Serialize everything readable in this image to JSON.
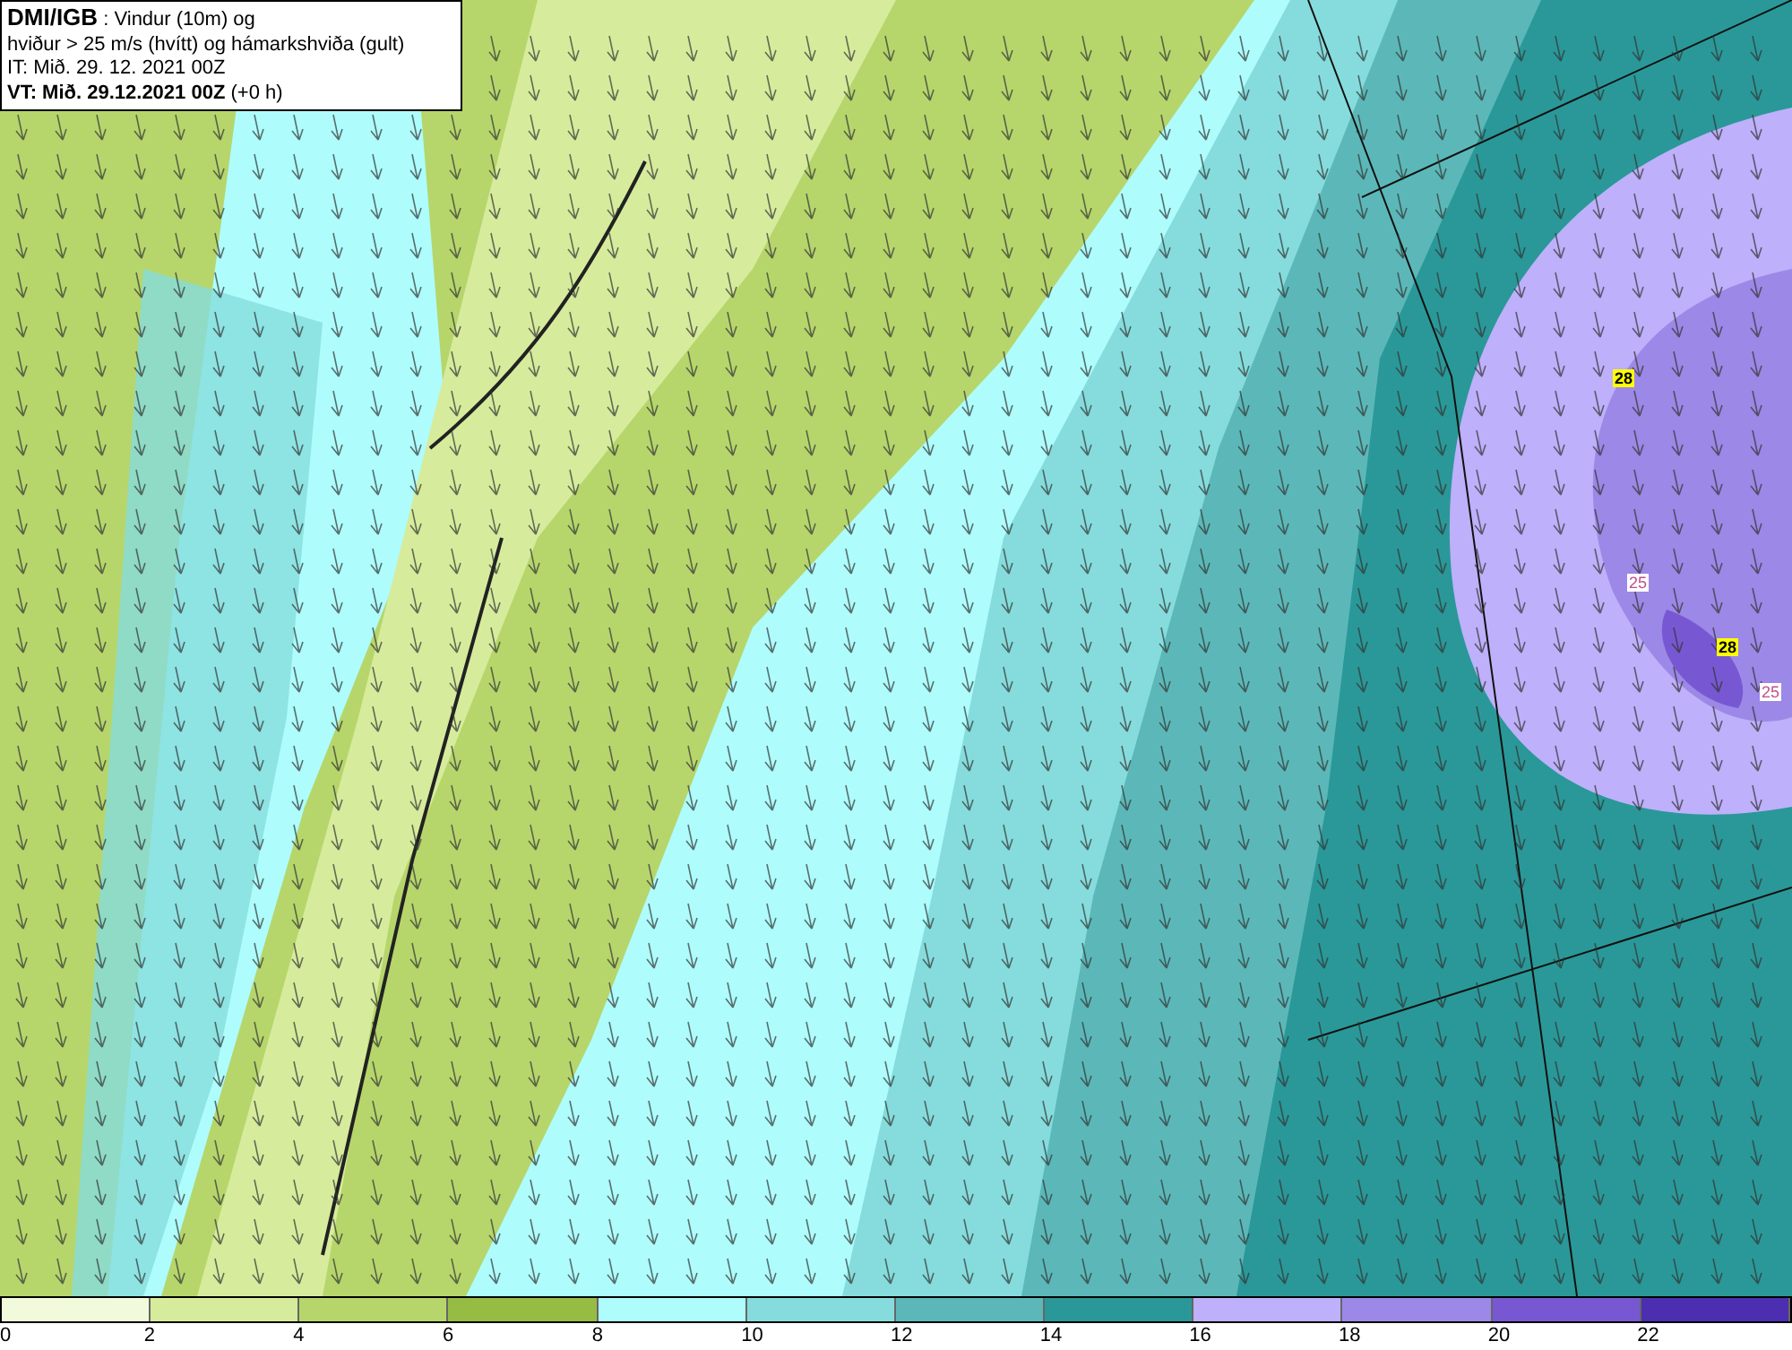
{
  "info_box": {
    "source": "DMI/IGB",
    "title": " : Vindur (10m) og",
    "subtitle": "hviður > 25 m/s (hvítt) og hámarkshviða (gult)",
    "issue_time": "IT: Mið. 29. 12. 2021 00Z",
    "valid_time": "VT: Mið. 29.12.2021 00Z",
    "offset": "(+0 h)"
  },
  "map": {
    "labels": [
      {
        "text": "28",
        "kind": "max-gust"
      },
      {
        "text": "25",
        "kind": "gust-contour"
      },
      {
        "text": "28",
        "kind": "max-gust"
      },
      {
        "text": "25",
        "kind": "gust-contour"
      }
    ]
  },
  "legend": {
    "bins": [
      {
        "color": "#f2fadc"
      },
      {
        "color": "#d6ec9c"
      },
      {
        "color": "#b6d66c"
      },
      {
        "color": "#96bc44"
      },
      {
        "color": "#aefcfc"
      },
      {
        "color": "#86dcdc"
      },
      {
        "color": "#5cb8b8"
      },
      {
        "color": "#2a9898"
      },
      {
        "color": "#beb0fa"
      },
      {
        "color": "#9c88e6"
      },
      {
        "color": "#7858d2"
      },
      {
        "color": "#4c2eb0"
      }
    ],
    "ticks": [
      "0",
      "2",
      "4",
      "6",
      "8",
      "10",
      "12",
      "14",
      "16",
      "18",
      "20",
      "22"
    ]
  }
}
